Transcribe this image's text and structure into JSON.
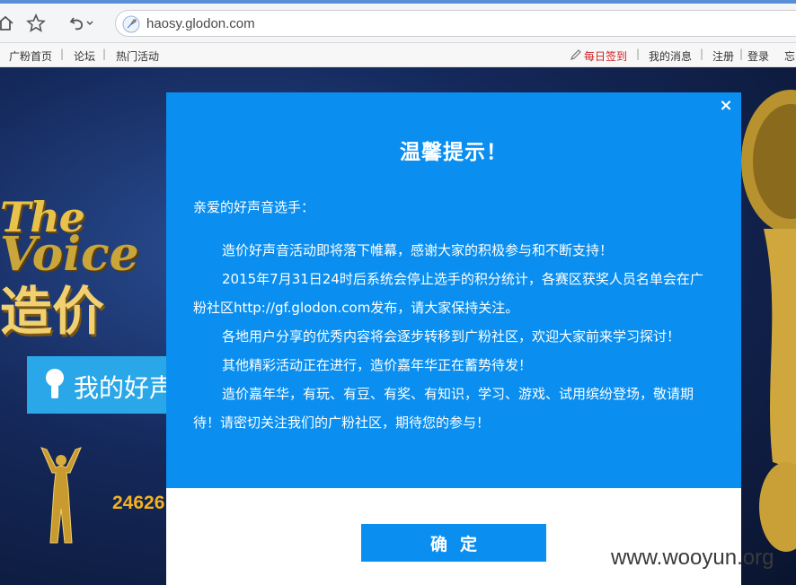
{
  "browser": {
    "url": "haosy.glodon.com",
    "icons": [
      "home-icon",
      "star-icon",
      "undo-icon",
      "chevron-down-icon",
      "rocket-icon"
    ]
  },
  "site_nav": {
    "left": [
      "广粉首页",
      "论坛",
      "热门活动"
    ],
    "separator": "|",
    "checkin": "每日签到",
    "right": [
      "我的消息",
      "注册",
      "登录",
      "忘"
    ]
  },
  "hero": {
    "title_en_1": "The",
    "title_en_2": "Voice",
    "title_cn": "造价",
    "my_voice_button": "我的好声",
    "count": "24626"
  },
  "modal": {
    "title": "温馨提示！",
    "close": "×",
    "greeting": "亲爱的好声音选手：",
    "paragraphs": [
      "造价好声音活动即将落下帷幕，感谢大家的积极参与和不断支持！",
      "2015年7月31日24时后系统会停止选手的积分统计，各赛区获奖人员名单会在广粉社区http://gf.glodon.com发布，请大家保持关注。",
      "各地用户分享的优秀内容将会逐步转移到广粉社区，欢迎大家前来学习探讨！",
      "其他精彩活动正在进行，造价嘉年华正在蓄势待发！",
      "造价嘉年华，有玩、有豆、有奖、有知识，学习、游戏、试用缤纷登场，敬请期待！请密切关注我们的广粉社区，期待您的参与！"
    ],
    "confirm": "确定"
  },
  "watermark": "www.wooyun.org",
  "colors": {
    "modal_blue": "#0a8ff0",
    "checkin_red": "#d21f1f",
    "count_gold": "#f5b21e"
  }
}
